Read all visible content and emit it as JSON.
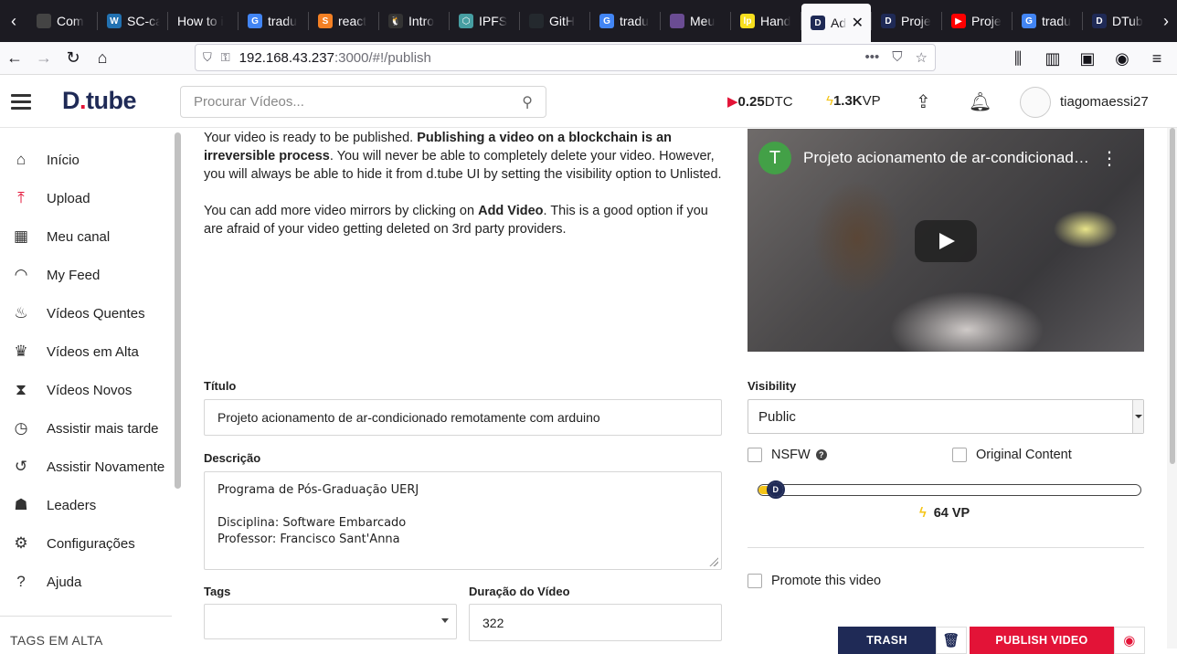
{
  "browser": {
    "tabs": [
      {
        "label": "Com",
        "fav": "#444",
        "glyph": ""
      },
      {
        "label": "SC-ca",
        "fav": "#2271b1",
        "glyph": "W"
      },
      {
        "label": "How to i",
        "fav": "",
        "glyph": ""
      },
      {
        "label": "tradu",
        "fav": "#4285f4",
        "glyph": "G"
      },
      {
        "label": "react",
        "fav": "#f48024",
        "glyph": "S"
      },
      {
        "label": "Intro",
        "fav": "#333",
        "glyph": "🐧"
      },
      {
        "label": "IPFS",
        "fav": "#469ea2",
        "glyph": "⬡"
      },
      {
        "label": "GitH",
        "fav": "#24292e",
        "glyph": ""
      },
      {
        "label": "tradu",
        "fav": "#4285f4",
        "glyph": "G"
      },
      {
        "label": "Meu",
        "fav": "#6a4c93",
        "glyph": ""
      },
      {
        "label": "Hand",
        "fav": "#f7df1e",
        "glyph": "lp"
      },
      {
        "label": "Ad",
        "fav": "#1f2a56",
        "glyph": "D",
        "active": true
      },
      {
        "label": "Proje",
        "fav": "#1f2a56",
        "glyph": "D"
      },
      {
        "label": "Proje",
        "fav": "#ff0000",
        "glyph": "▶"
      },
      {
        "label": "tradu",
        "fav": "#4285f4",
        "glyph": "G"
      },
      {
        "label": "DTub",
        "fav": "#1f2a56",
        "glyph": "D"
      }
    ],
    "url_host": "192.168.43.237",
    "url_path": ":3000/#!/publish"
  },
  "header": {
    "logo_main": "D",
    "logo_dot": ".",
    "logo_rest": "tube",
    "search_placeholder": "Procurar Vídeos...",
    "dtc_value": "0.25",
    "dtc_unit": "DTC",
    "vp_value": "1.3K",
    "vp_unit": "VP",
    "username": "tiagomaessi27"
  },
  "sidebar": {
    "items": [
      {
        "label": "Início",
        "icon": "home-icon",
        "glyph": "⌂"
      },
      {
        "label": "Upload",
        "icon": "upload-icon",
        "glyph": "⤒"
      },
      {
        "label": "Meu canal",
        "icon": "grid-icon",
        "glyph": "▦"
      },
      {
        "label": "My Feed",
        "icon": "rss-icon",
        "glyph": "◠"
      },
      {
        "label": "Vídeos Quentes",
        "icon": "fire-icon",
        "glyph": "♨"
      },
      {
        "label": "Vídeos em Alta",
        "icon": "trophy-icon",
        "glyph": "♛"
      },
      {
        "label": "Vídeos Novos",
        "icon": "hourglass-icon",
        "glyph": "⧗"
      },
      {
        "label": "Assistir mais tarde",
        "icon": "clock-icon",
        "glyph": "◷"
      },
      {
        "label": "Assistir Novamente",
        "icon": "history-icon",
        "glyph": "↺"
      },
      {
        "label": "Leaders",
        "icon": "users-icon",
        "glyph": "☗"
      },
      {
        "label": "Configurações",
        "icon": "cogs-icon",
        "glyph": "⚙"
      },
      {
        "label": "Ajuda",
        "icon": "help-icon",
        "glyph": "?"
      }
    ],
    "tags_title": "TAGS EM ALTA"
  },
  "intro": {
    "p1_start": "Your video is ready to be published. ",
    "p1_bold": "Publishing a video on a blockchain is an irreversible process",
    "p1_end": ". You will never be able to completely delete your video. However, you will always be able to hide it from d.tube UI by setting the visibility option to Unlisted.",
    "p2_start": "You can add more video mirrors by clicking on ",
    "p2_bold": "Add Video",
    "p2_end": ". This is a good option if you are afraid of your video getting deleted on 3rd party providers."
  },
  "player": {
    "channel_initial": "T",
    "title": "Projeto acionamento de ar-condicionado remotamente com arduino"
  },
  "form": {
    "title_label": "Título",
    "title_value": "Projeto acionamento de ar-condicionado remotamente com arduino",
    "desc_label": "Descrição",
    "desc_value": "Programa de Pós-Graduação UERJ\n\nDisciplina: Software Embarcado\nProfessor: Francisco Sant'Anna",
    "tags_label": "Tags",
    "duration_label": "Duração do Vídeo",
    "duration_value": "322",
    "visibility_label": "Visibility",
    "visibility_value": "Public",
    "nsfw_label": "NSFW",
    "original_label": "Original Content",
    "vp_fraction": 0.045,
    "vp_spend": "64 VP",
    "promote_label": "Promote this video",
    "trash_label": "TRASH",
    "publish_label": "PUBLISH VIDEO"
  }
}
